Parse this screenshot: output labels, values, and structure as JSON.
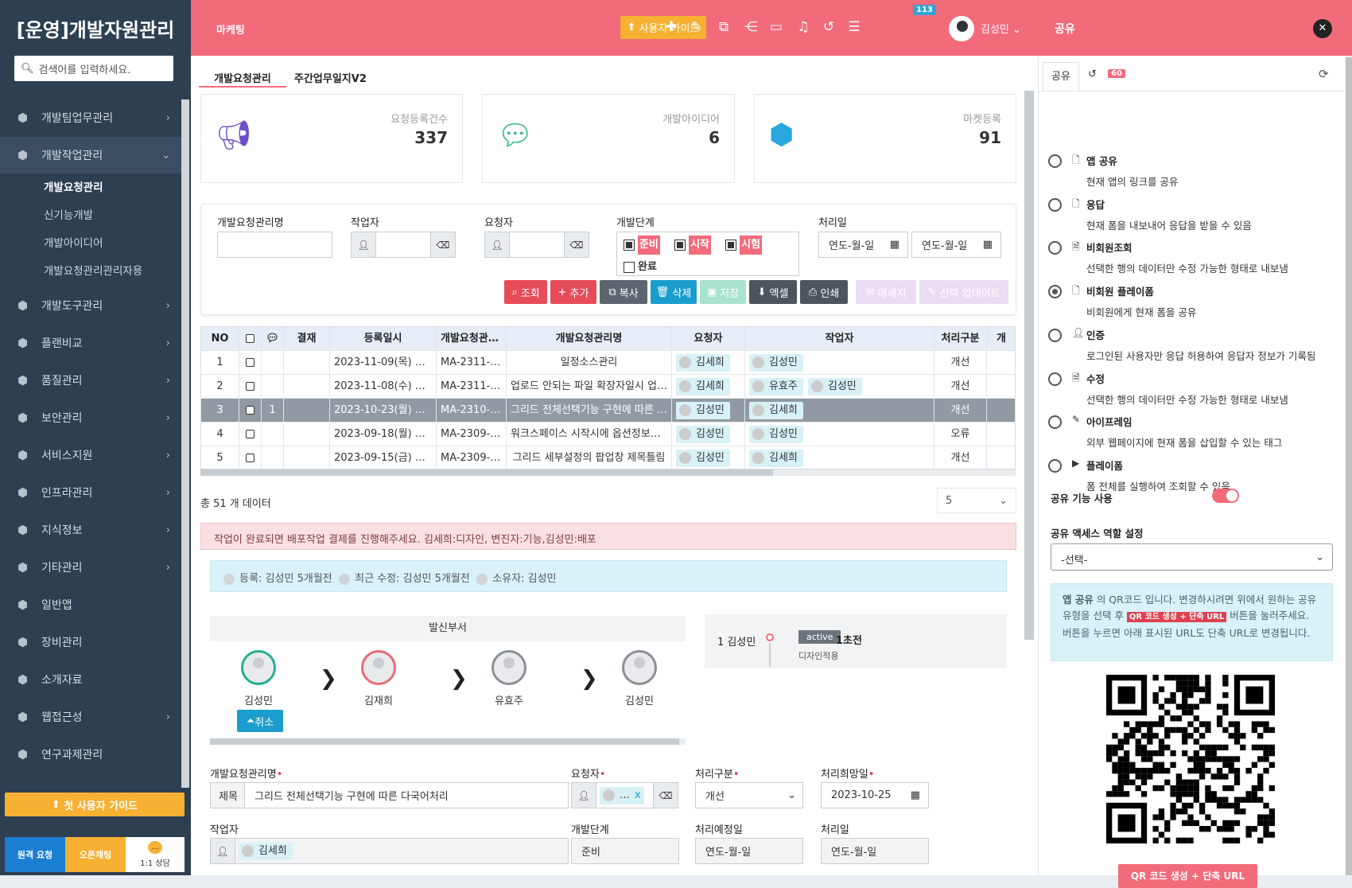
{
  "app_title": "[운영]개발자원관리",
  "search_placeholder": "검색어를 입력하세요.",
  "sidebar": {
    "items": [
      {
        "label": "개발팀업무관리"
      },
      {
        "label": "개발작업관리"
      },
      {
        "label": "개발도구관리"
      },
      {
        "label": "플랜비교"
      },
      {
        "label": "품질관리"
      },
      {
        "label": "보안관리"
      },
      {
        "label": "서비스지원"
      },
      {
        "label": "인프라관리"
      },
      {
        "label": "지식정보"
      },
      {
        "label": "기타관리"
      },
      {
        "label": "일반앱"
      },
      {
        "label": "장비관리"
      },
      {
        "label": "소개자료"
      },
      {
        "label": "웹접근성"
      },
      {
        "label": "연구과제관리"
      }
    ],
    "sub_items": [
      "개발요청관리",
      "신기능개발",
      "개발아이디어",
      "개발요청관리관리자용"
    ],
    "guide_button": "첫 사용자 가이드",
    "bottom": {
      "remote": "원격 요청",
      "open_chat": "오픈채팅",
      "consult": "1:1 상담"
    }
  },
  "header": {
    "section": "마케팅",
    "user_guide": "사용자 가이드",
    "notification_count": "113",
    "user_name": "김성민",
    "share_title": "공유"
  },
  "tabs": [
    "개발요청관리",
    "주간업무일지V2"
  ],
  "stats": [
    {
      "label": "요청등록건수",
      "value": "337",
      "icon": "megaphone-icon",
      "color": "#6b4fc8"
    },
    {
      "label": "개발아이디어",
      "value": "6",
      "icon": "chat-bubbles-icon",
      "color": "#22b573"
    },
    {
      "label": "마켓등록",
      "value": "91",
      "icon": "cube-icon",
      "color": "#29a8e0"
    }
  ],
  "filter": {
    "name_label": "개발요청관리명",
    "worker_label": "작업자",
    "requester_label": "요청자",
    "stage_label": "개발단계",
    "stages": [
      "준비",
      "시작",
      "시험",
      "완료"
    ],
    "date_label": "처리일",
    "date_placeholder": "연도-월-일",
    "buttons": [
      "조회",
      "추가",
      "복사",
      "삭제",
      "저장",
      "엑셀",
      "인쇄",
      "메세지",
      "선택 업데이트"
    ]
  },
  "grid": {
    "columns": [
      "NO",
      "",
      "",
      "결재",
      "등록일시",
      "개발요청관리…",
      "개발요청관리명",
      "요청자",
      "작업자",
      "처리구분",
      "개"
    ],
    "rows": [
      {
        "no": "1",
        "count": "",
        "date": "2023-11-09(목) 17:25",
        "code": "MA-2311-00…",
        "name": "일정소스관리",
        "requester": "김세희",
        "workers": [
          "김성민"
        ],
        "type": "개선"
      },
      {
        "no": "2",
        "count": "",
        "date": "2023-11-08(수) 11:33",
        "code": "MA-2311-00…",
        "name": "업로드 안되는 파일 확장자일시 업로…",
        "requester": "김세희",
        "workers": [
          "유효주",
          "김성민"
        ],
        "type": "개선"
      },
      {
        "no": "3",
        "count": "1",
        "date": "2023-10-23(월) 06:02",
        "code": "MA-2310-00…",
        "name": "그리드 전체선택기능 구현에 따른 다…",
        "requester": "김성민",
        "workers": [
          "김세희"
        ],
        "type": "개선"
      },
      {
        "no": "4",
        "count": "",
        "date": "2023-09-18(월) 09:14",
        "code": "MA-2309-00…",
        "name": "워크스페이스 시작시에 옵션정보를 …",
        "requester": "김성민",
        "workers": [
          "김성민"
        ],
        "type": "오류"
      },
      {
        "no": "5",
        "count": "",
        "date": "2023-09-15(금) 09:46",
        "code": "MA-2309-00…",
        "name": "그리드 세부설정의 팝업창 제목틀림",
        "requester": "김성민",
        "workers": [
          "김세희"
        ],
        "type": "개선"
      }
    ]
  },
  "total_text": "총 51 개 데이터",
  "page_size": "5",
  "notice": "작업이 완료되면 배포작업 결제를 진행해주세요. 김세희:디자인, 변진자:기능,김성민:배포",
  "meta": {
    "registered": "등록: 김성민 5개월전",
    "modified": "최근 수정: 김성민 5개월전",
    "owner": "소유자: 김성민"
  },
  "approval": {
    "header": "발신부서",
    "nodes": [
      {
        "name": "김성민",
        "color": "#22b08f"
      },
      {
        "name": "김재희",
        "color": "#e86b78"
      },
      {
        "name": "유효주",
        "color": "#8a9096"
      },
      {
        "name": "김성민",
        "color": "#8a9096"
      }
    ],
    "cancel": "취소"
  },
  "history": {
    "name": "1 김성민",
    "badge": "active",
    "time": "1초전",
    "step": "디자인적용"
  },
  "form": {
    "name_label": "개발요청관리명",
    "title_prefix": "제목",
    "title_value": "그리드 전체선택기능 구현에 따른 다국어처리",
    "requester_label": "요청자",
    "type_label": "처리구분",
    "type_value": "개선",
    "due_label": "처리희망일",
    "due_value": "2023-10-25",
    "worker_label": "작업자",
    "worker_value": "김세희",
    "stage_label": "개발단계",
    "stage_value": "준비",
    "planned_label": "처리예정일",
    "planned_value": "연도-월-일",
    "done_label": "처리일",
    "done_value": "연도-월-일"
  },
  "share": {
    "tab": "공유",
    "history_count": "60",
    "options": [
      {
        "title": "앱 공유",
        "desc": "현재 앱의 링크를 공유",
        "icon": "document-icon",
        "selected": false
      },
      {
        "title": "응답",
        "desc": "현재 폼을 내보내어 응답을 받을 수 있음",
        "icon": "document-icon",
        "selected": false
      },
      {
        "title": "비회원조회",
        "desc": "선택한 행의 데이터만 수정 가능한 형태로 내보냄",
        "icon": "document-text-icon",
        "selected": false
      },
      {
        "title": "비회원 플레이폼",
        "desc": "비회원에게 현재 폼을 공유",
        "icon": "document-icon",
        "selected": true
      },
      {
        "title": "인증",
        "desc": "로그인된 사용자만 응답 허용하여 응답자 정보가 기록됨",
        "icon": "user-icon",
        "selected": false
      },
      {
        "title": "수정",
        "desc": "선택한 행의 데이터만 수정 가능한 형태로 내보냄",
        "icon": "document-text-icon",
        "selected": false
      },
      {
        "title": "아이프레임",
        "desc": "외부 웹페이지에 현재 폼을 삽입할 수 있는 태그",
        "icon": "edit-icon",
        "selected": false
      },
      {
        "title": "플레이폼",
        "desc": "폼 전체를 실행하여 조회할 수 있음",
        "icon": "play-icon",
        "selected": false
      }
    ],
    "toggle_label": "공유 기능 사용",
    "role_label": "공유 액세스 역할 설정",
    "role_value": "-선택-",
    "info_bold": "앱 공유",
    "info_text1": " 의 QR코드 입니다. 변경하시려면 위에서 원하는 공유 유형을 선택 후 ",
    "info_pill": "QR 코드 생성 + 단축 URL",
    "info_text2": " 버튼을 눌러주세요. 버튼을 누르면 아래 표시된 URL도 단축 URL로 변경됩니다.",
    "qr_button": "QR 코드 생성 + 단축 URL"
  }
}
